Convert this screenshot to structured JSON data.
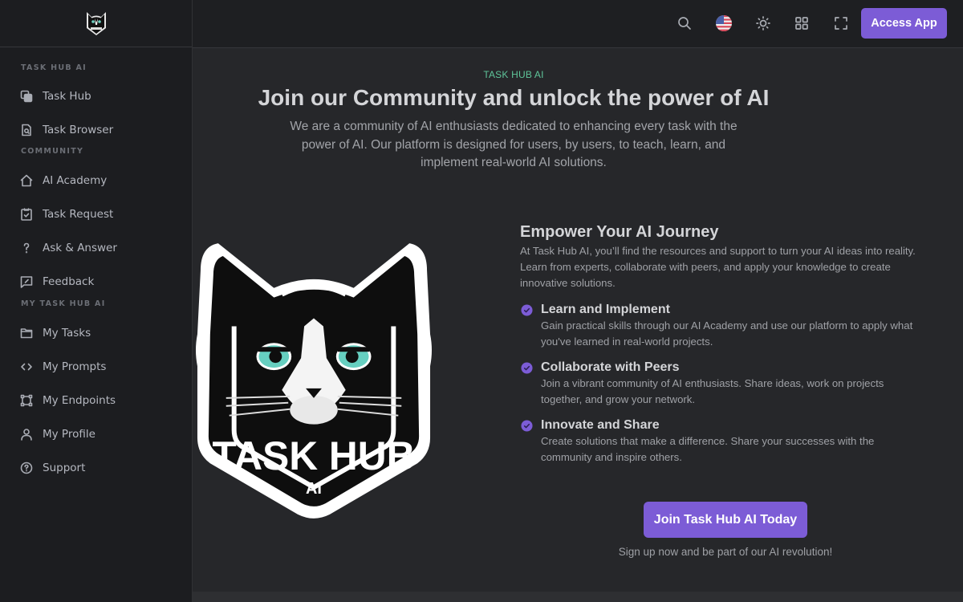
{
  "sidebar": {
    "logo_alt": "Task Hub AI logo",
    "sections": [
      {
        "label": "TASK HUB AI",
        "items": [
          {
            "label": "Task Hub",
            "icon": "stacked-squares-icon"
          },
          {
            "label": "Task Browser",
            "icon": "file-search-icon"
          }
        ]
      },
      {
        "label": "COMMUNITY",
        "items": [
          {
            "label": "AI Academy",
            "icon": "home-icon"
          },
          {
            "label": "Task Request",
            "icon": "clipboard-check-icon"
          },
          {
            "label": "Ask & Answer",
            "icon": "question-mark-icon"
          },
          {
            "label": "Feedback",
            "icon": "message-edit-icon"
          }
        ]
      },
      {
        "label": "MY TASK HUB AI",
        "items": [
          {
            "label": "My Tasks",
            "icon": "folder-icon"
          },
          {
            "label": "My Prompts",
            "icon": "code-icon"
          },
          {
            "label": "My Endpoints",
            "icon": "vector-square-icon"
          },
          {
            "label": "My Profile",
            "icon": "user-icon"
          },
          {
            "label": "Support",
            "icon": "help-circle-icon"
          }
        ]
      }
    ]
  },
  "header": {
    "icons": [
      "search-icon",
      "us-flag-icon",
      "sun-icon",
      "grid-icon",
      "fullscreen-icon"
    ],
    "access_label": "Access App"
  },
  "hero": {
    "eyebrow": "TASK HUB AI",
    "title": "Join our Community and unlock the power of AI",
    "subtitle": "We are a community of AI enthusiasts dedicated to enhancing every task with the power of AI. Our platform is designed for users, by users, to teach, learn, and implement real-world AI solutions."
  },
  "logo_badge": {
    "line1": "TASK HUB",
    "line2": "AI"
  },
  "journey": {
    "title": "Empower Your AI Journey",
    "body": "At Task Hub AI, you’ll find the resources and support to turn your AI ideas into reality. Learn from experts, collaborate with peers, and apply your knowledge to create innovative solutions.",
    "features": [
      {
        "title": "Learn and Implement",
        "desc": "Gain practical skills through our AI Academy and use our platform to apply what you've learned in real-world projects."
      },
      {
        "title": "Collaborate with Peers",
        "desc": "Join a vibrant community of AI enthusiasts. Share ideas, work on projects together, and grow your network."
      },
      {
        "title": "Innovate and Share",
        "desc": "Create solutions that make a difference. Share your successes with the community and inspire others."
      }
    ]
  },
  "cta": {
    "button": "Join Task Hub AI Today",
    "note": "Sign up now and be part of our AI revolution!"
  },
  "colors": {
    "accent": "#7c5cd6",
    "eyebrow": "#5fc59a",
    "sidebar_bg": "#1c1d20",
    "main_bg": "#26272a"
  }
}
